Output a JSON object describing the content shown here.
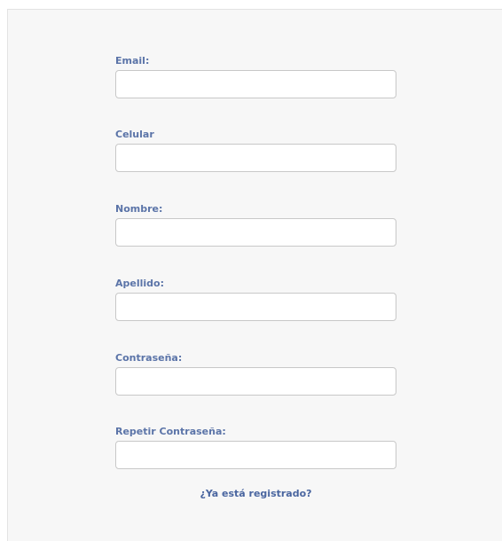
{
  "form": {
    "fields": [
      {
        "label": "Email:",
        "value": "",
        "placeholder": ""
      },
      {
        "label": "Celular",
        "value": "",
        "placeholder": ""
      },
      {
        "label": "Nombre:",
        "value": "",
        "placeholder": ""
      },
      {
        "label": "Apellido:",
        "value": "",
        "placeholder": ""
      },
      {
        "label": "Contraseña:",
        "value": "",
        "placeholder": ""
      },
      {
        "label": "Repetir Contraseña:",
        "value": "",
        "placeholder": ""
      }
    ],
    "login_link": "¿Ya está registrado?"
  },
  "colors": {
    "label": "#5b74a8",
    "link": "#4a66a0",
    "panel_background": "#f7f7f7",
    "input_border": "#c8c8c8"
  }
}
